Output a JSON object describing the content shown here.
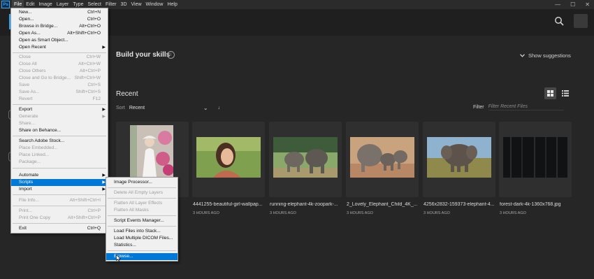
{
  "menubar": {
    "logo": "Ps",
    "items": [
      "File",
      "Edit",
      "Image",
      "Layer",
      "Type",
      "Select",
      "Filter",
      "3D",
      "View",
      "Window",
      "Help"
    ],
    "controls": [
      "—",
      "☐",
      "✕"
    ]
  },
  "home": {
    "build_title": "Build your skills",
    "show_suggestions": "Show suggestions",
    "recent_title": "Recent",
    "sort_label": "Sort",
    "sort_value": "Recent",
    "filter_label": "Filter",
    "filter_placeholder": "Filter Recent Files"
  },
  "recent_files": [
    {
      "title": "",
      "time": ""
    },
    {
      "title": "4441255-beautiful-girl-wallpap...",
      "time": "3 HOURS AGO"
    },
    {
      "title": "running-elephant-4k-zoopark-...",
      "time": "3 HOURS AGO"
    },
    {
      "title": "2_Lovely_Elephant_Child_4K_...",
      "time": "3 HOURS AGO"
    },
    {
      "title": "4256x2832-159373-elephant-4...",
      "time": "3 HOURS AGO"
    },
    {
      "title": "forest-dark-4k-1360x768.jpg",
      "time": "3 HOURS AGO"
    }
  ],
  "file_menu": [
    {
      "label": "New...",
      "shortcut": "Ctrl+N"
    },
    {
      "label": "Open...",
      "shortcut": "Ctrl+O"
    },
    {
      "label": "Browse in Bridge...",
      "shortcut": "Alt+Ctrl+O"
    },
    {
      "label": "Open As...",
      "shortcut": "Alt+Shift+Ctrl+O"
    },
    {
      "label": "Open as Smart Object...",
      "shortcut": ""
    },
    {
      "label": "Open Recent",
      "shortcut": "",
      "submenu": true
    },
    {
      "label": "Close",
      "shortcut": "Ctrl+W",
      "disabled": true
    },
    {
      "label": "Close All",
      "shortcut": "Alt+Ctrl+W",
      "disabled": true
    },
    {
      "label": "Close Others",
      "shortcut": "Alt+Ctrl+P",
      "disabled": true
    },
    {
      "label": "Close and Go to Bridge...",
      "shortcut": "Shift+Ctrl+W",
      "disabled": true
    },
    {
      "label": "Save",
      "shortcut": "Ctrl+S",
      "disabled": true
    },
    {
      "label": "Save As...",
      "shortcut": "Shift+Ctrl+S",
      "disabled": true
    },
    {
      "label": "Revert",
      "shortcut": "F12",
      "disabled": true
    },
    {
      "label": "Export",
      "shortcut": "",
      "submenu": true
    },
    {
      "label": "Generate",
      "shortcut": "",
      "submenu": true,
      "disabled": true
    },
    {
      "label": "Share...",
      "shortcut": "",
      "disabled": true
    },
    {
      "label": "Share on Behance...",
      "shortcut": ""
    },
    {
      "label": "Search Adobe Stock...",
      "shortcut": ""
    },
    {
      "label": "Place Embedded...",
      "shortcut": "",
      "disabled": true
    },
    {
      "label": "Place Linked...",
      "shortcut": "",
      "disabled": true
    },
    {
      "label": "Package...",
      "shortcut": "",
      "disabled": true
    },
    {
      "label": "Automate",
      "shortcut": "",
      "submenu": true
    },
    {
      "label": "Scripts",
      "shortcut": "",
      "submenu": true,
      "highlighted": true
    },
    {
      "label": "Import",
      "shortcut": "",
      "submenu": true
    },
    {
      "label": "File Info...",
      "shortcut": "Alt+Shift+Ctrl+I",
      "disabled": true
    },
    {
      "label": "Print...",
      "shortcut": "Ctrl+P",
      "disabled": true
    },
    {
      "label": "Print One Copy",
      "shortcut": "Alt+Shift+Ctrl+P",
      "disabled": true
    },
    {
      "label": "Exit",
      "shortcut": "Ctrl+Q"
    }
  ],
  "scripts_menu": [
    {
      "label": "Image Processor..."
    },
    {
      "label": "Delete All Empty Layers",
      "disabled": true
    },
    {
      "label": "Flatten All Layer Effects",
      "disabled": true
    },
    {
      "label": "Flatten All Masks",
      "disabled": true
    },
    {
      "label": "Script Events Manager..."
    },
    {
      "label": "Load Files into Stack..."
    },
    {
      "label": "Load Multiple DICOM Files..."
    },
    {
      "label": "Statistics..."
    },
    {
      "label": "Browse...",
      "highlighted": true
    }
  ],
  "colors": {
    "accent": "#31a8ff",
    "highlight": "#0078d7",
    "background": "#262626",
    "menu_bg": "#f0f0f0"
  }
}
